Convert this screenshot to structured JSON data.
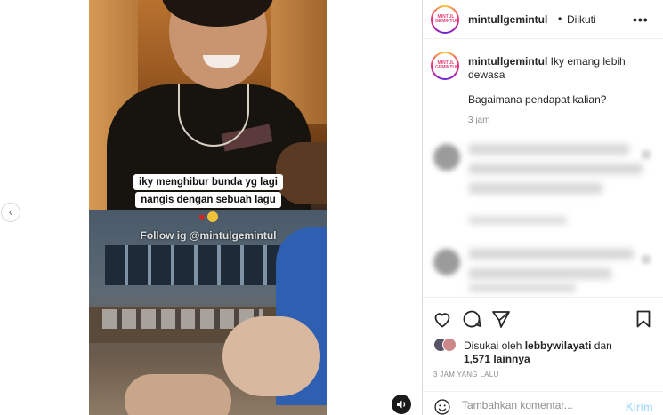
{
  "media": {
    "caption_line1": "iky menghibur bunda yg lagi",
    "caption_line2": "nangis dengan sebuah lagu",
    "caption_emoji": "♥",
    "watermark": "Follow ig @mintulgemintul",
    "prev_icon": "‹"
  },
  "post": {
    "avatar_text": "MINTUL GEMINTUL",
    "username": "mintullgemintul",
    "separator": "•",
    "follow_status": "Diikuti",
    "more_icon": "•••",
    "caption_username": "mintullgemintul",
    "caption_text": "Iky emang lebih dewasa",
    "caption_question": "Bagaimana pendapat kalian?",
    "caption_time": "3 jam"
  },
  "actions": {
    "icons": [
      "heart-icon",
      "comment-icon",
      "share-icon",
      "bookmark-icon"
    ],
    "likes_prefix": "Disukai oleh",
    "likes_user": "lebbywilayati",
    "likes_joiner": "dan",
    "likes_count": "1,571 lainnya",
    "post_time": "3 JAM YANG LALU"
  },
  "comment_box": {
    "placeholder": "Tambahkan komentar...",
    "post_label": "Kirim"
  },
  "colors": {
    "accent_link": "#b2dffc",
    "text": "#262626",
    "muted": "#8e8e8e",
    "divider": "#efefef"
  }
}
